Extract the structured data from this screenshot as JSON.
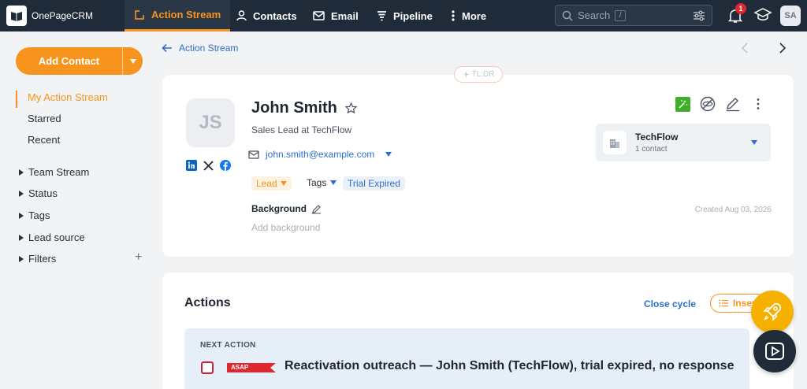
{
  "app": {
    "name": "OnePage",
    "name_suffix": "CRM"
  },
  "nav": {
    "items": [
      {
        "label": "Action Stream",
        "icon": "action-stream-icon",
        "active": true
      },
      {
        "label": "Contacts",
        "icon": "person-icon"
      },
      {
        "label": "Email",
        "icon": "envelope-icon"
      },
      {
        "label": "Pipeline",
        "icon": "funnel-icon"
      },
      {
        "label": "More",
        "icon": "vertical-dots-icon"
      }
    ],
    "search_placeholder": "Search",
    "search_shortcut": "/",
    "notifications_count": "1",
    "user_initials": "SA"
  },
  "sidebar": {
    "add_contact_label": "Add Contact",
    "items": [
      {
        "label": "My Action Stream",
        "active": true
      },
      {
        "label": "Starred"
      },
      {
        "label": "Recent"
      }
    ],
    "groups": [
      {
        "label": "Team Stream"
      },
      {
        "label": "Status"
      },
      {
        "label": "Tags"
      },
      {
        "label": "Lead source"
      },
      {
        "label": "Filters"
      }
    ],
    "add_symbol": "+"
  },
  "breadcrumb": {
    "label": "Action Stream"
  },
  "tldr": "TL;DR",
  "contact": {
    "initials": "JS",
    "name": "John Smith",
    "title": "Sales Lead at TechFlow",
    "email": "john.smith@example.com",
    "status": "Lead",
    "tags_label": "Tags",
    "tag": "Trial Expired",
    "background_label": "Background",
    "background_placeholder": "Add background",
    "created": "Created Aug 03, 2026",
    "company": {
      "name": "TechFlow",
      "count": "1 contact"
    }
  },
  "actions": {
    "title": "Actions",
    "close_cycle": "Close cycle",
    "insert_label": "Insert",
    "next_label": "NEXT ACTION",
    "next_badge": "ASAP",
    "next_text": "Reactivation outreach — John Smith (TechFlow), trial expired, no response"
  },
  "colors": {
    "accent": "#f7941d",
    "nav_bg": "#1f2b39",
    "link": "#2f6fc9",
    "asap": "#e0262f"
  }
}
